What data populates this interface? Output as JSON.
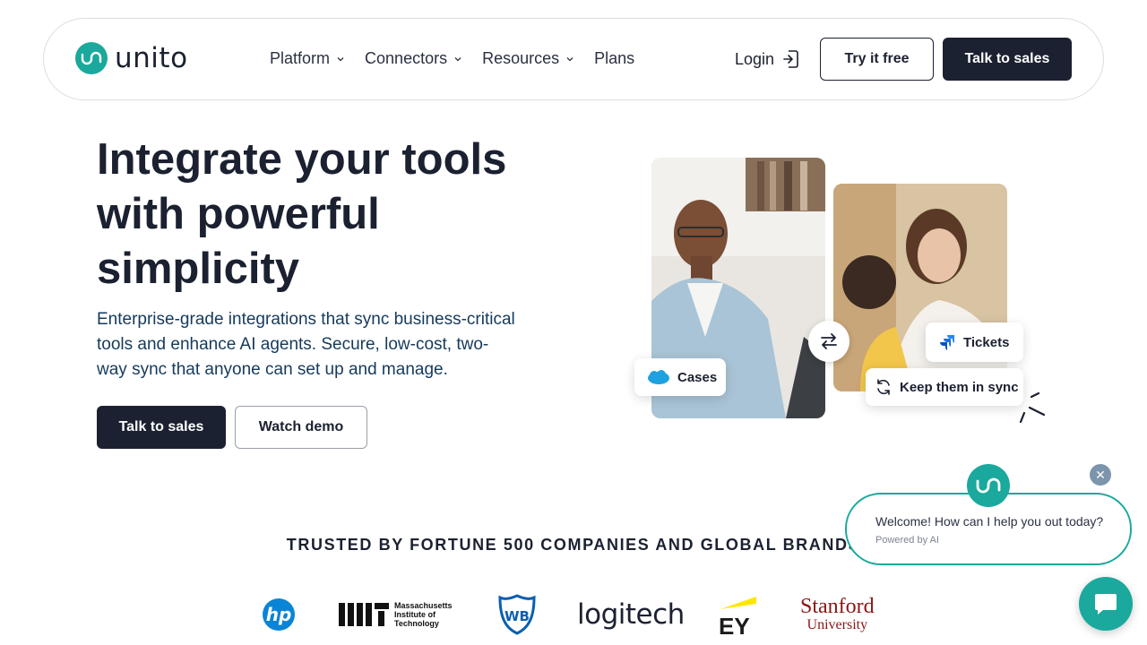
{
  "brand": {
    "name": "unito",
    "accent": "#1aa99c",
    "dark": "#1b2130"
  },
  "nav": {
    "items": [
      {
        "label": "Platform",
        "has_dropdown": true
      },
      {
        "label": "Connectors",
        "has_dropdown": true
      },
      {
        "label": "Resources",
        "has_dropdown": true
      },
      {
        "label": "Plans",
        "has_dropdown": false
      }
    ],
    "login_label": "Login",
    "try_label": "Try it free",
    "sales_label": "Talk to sales"
  },
  "hero": {
    "title": "Integrate your tools with powerful simplicity",
    "subtitle": "Enterprise-grade integrations that sync business-critical tools and enhance AI agents. Secure, low-cost, two-way sync that anyone can set up and manage.",
    "primary_cta": "Talk to sales",
    "secondary_cta": "Watch demo"
  },
  "illustration": {
    "chip_cases": "Cases",
    "chip_tickets": "Tickets",
    "chip_sync": "Keep them in sync"
  },
  "trusted": {
    "heading": "TRUSTED BY FORTUNE 500 COMPANIES AND GLOBAL BRANDS",
    "logos": {
      "hp": "hp",
      "mit_line1": "Massachusetts",
      "mit_line2": "Institute of",
      "mit_line3": "Technology",
      "wb": "WB",
      "logitech": "logitech",
      "ey": "EY",
      "stanford_line1": "Stanford",
      "stanford_line2": "University"
    }
  },
  "chat": {
    "message": "Welcome! How can I help you out today?",
    "powered": "Powered by AI"
  }
}
